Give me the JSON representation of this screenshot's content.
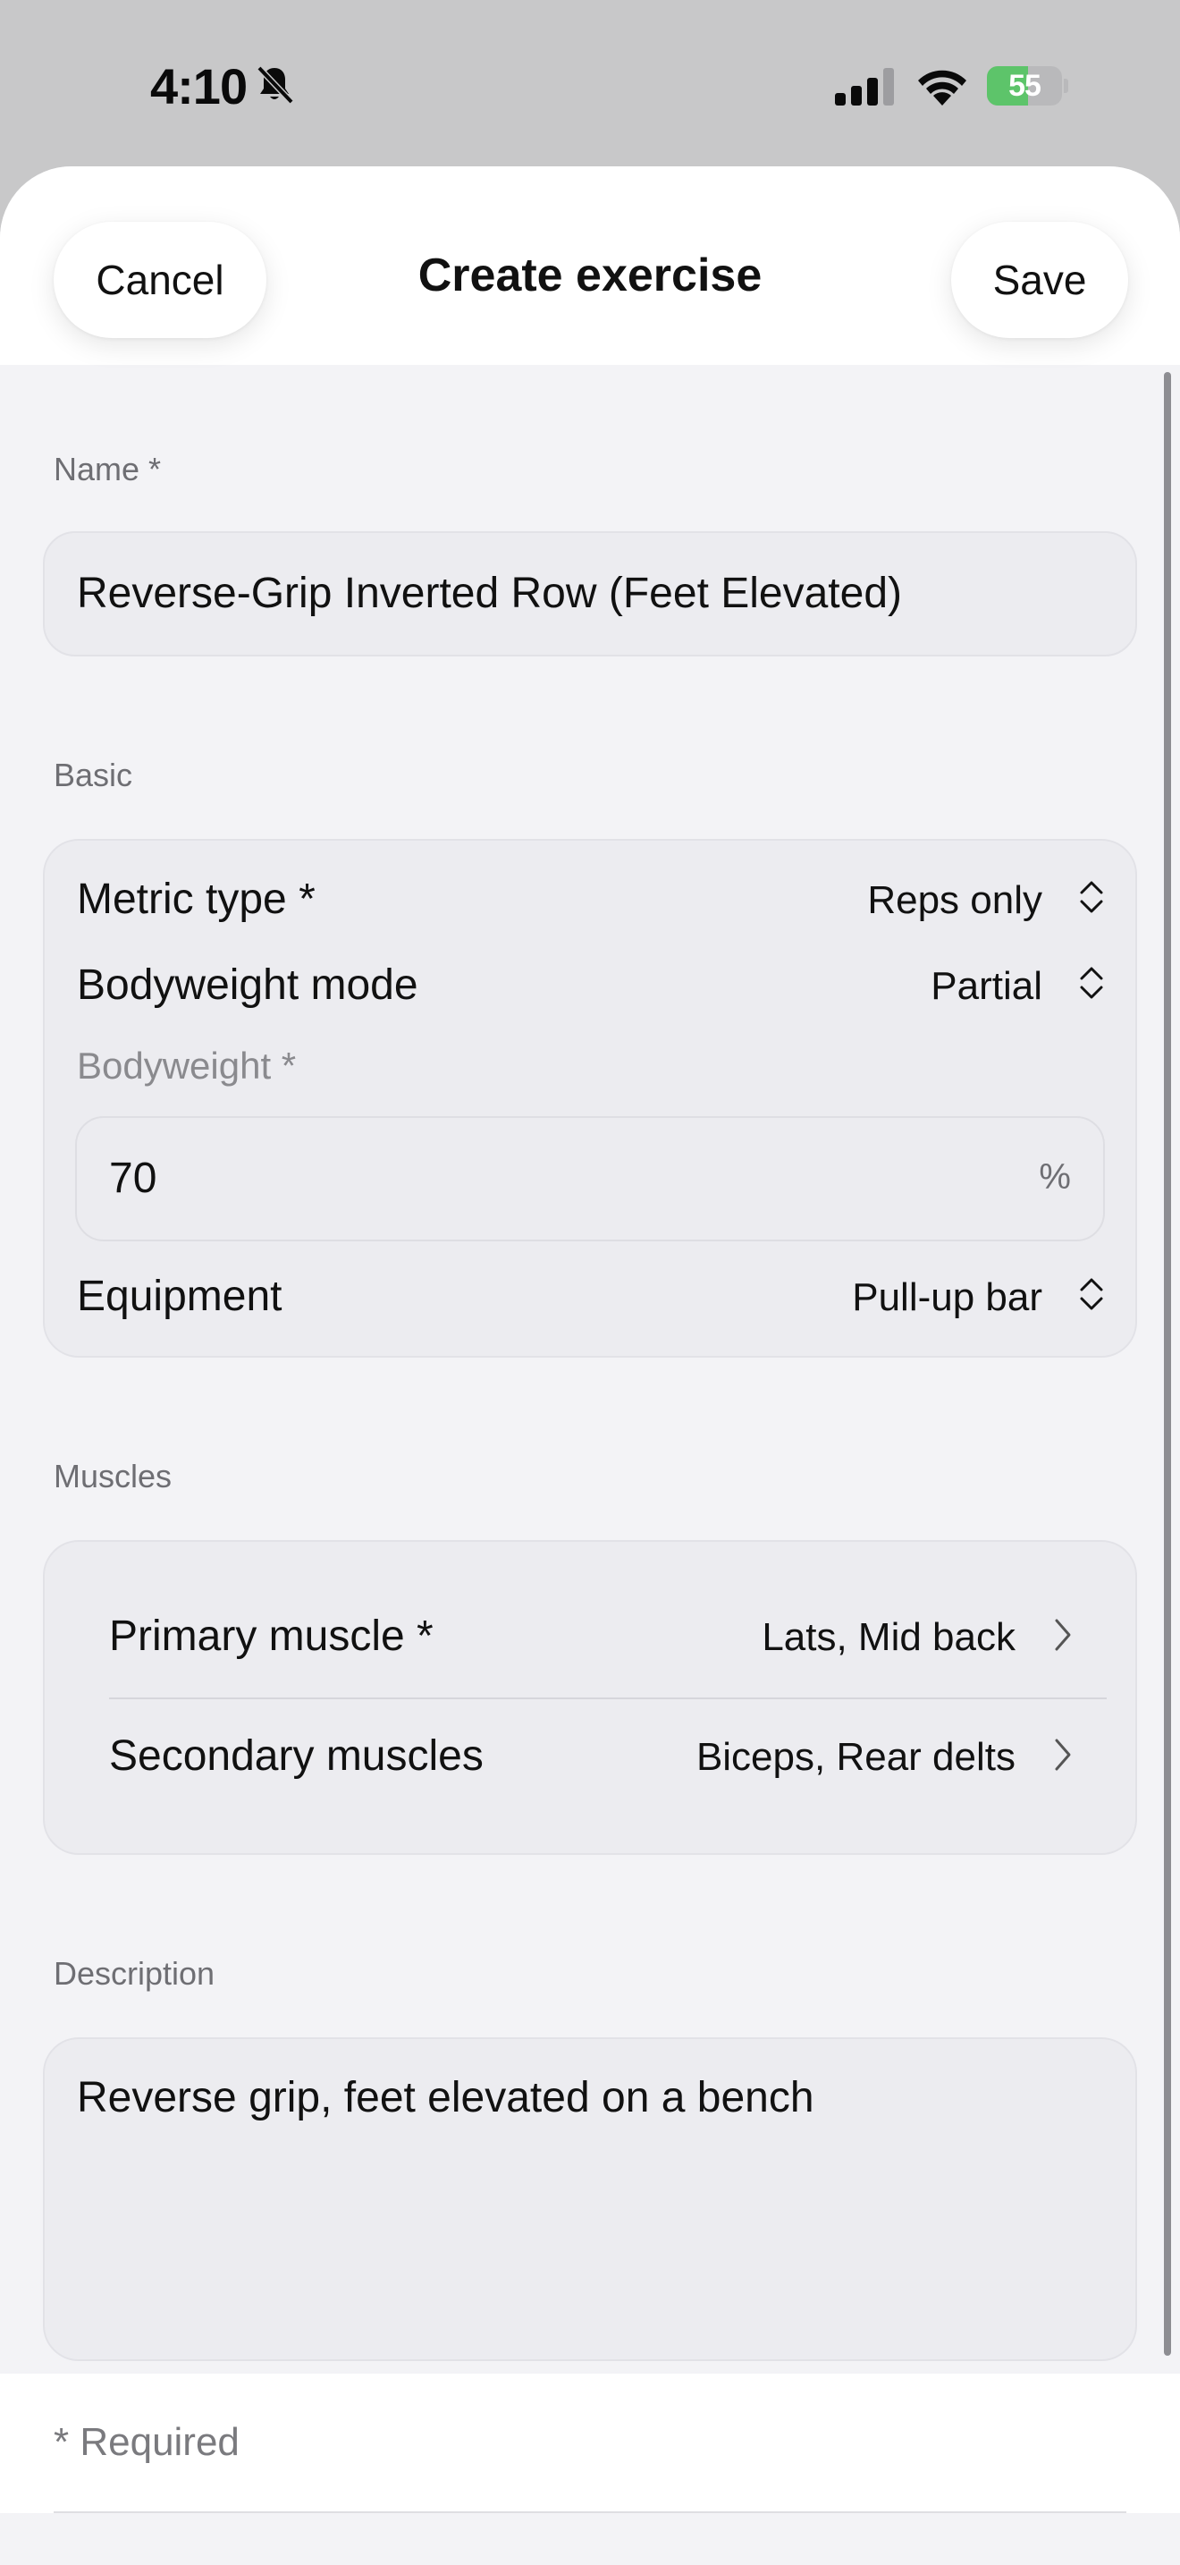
{
  "status_bar": {
    "time": "4:10",
    "battery_level": "55",
    "battery_fraction": 0.55,
    "battery_color": "#5dc46a",
    "icons": [
      "bell-slash-icon",
      "cellular-signal-icon",
      "wifi-icon",
      "battery-charging-icon"
    ]
  },
  "nav": {
    "cancel_label": "Cancel",
    "title": "Create exercise",
    "save_label": "Save"
  },
  "name_section": {
    "label": "Name *",
    "value": "Reverse-Grip Inverted Row (Feet Elevated)"
  },
  "basic_section": {
    "label": "Basic",
    "metric_type": {
      "label": "Metric type *",
      "value": "Reps only"
    },
    "bodyweight_mode": {
      "label": "Bodyweight mode",
      "value": "Partial"
    },
    "bodyweight": {
      "label": "Bodyweight *",
      "value": "70",
      "unit": "%"
    },
    "equipment": {
      "label": "Equipment",
      "value": "Pull-up bar"
    }
  },
  "muscles_section": {
    "label": "Muscles",
    "primary": {
      "label": "Primary muscle *",
      "value": "Lats, Mid back"
    },
    "secondary": {
      "label": "Secondary muscles",
      "value": "Biceps, Rear delts"
    }
  },
  "description_section": {
    "label": "Description",
    "value": "Reverse grip, feet elevated on a bench"
  },
  "footer": {
    "required_note": "* Required"
  }
}
